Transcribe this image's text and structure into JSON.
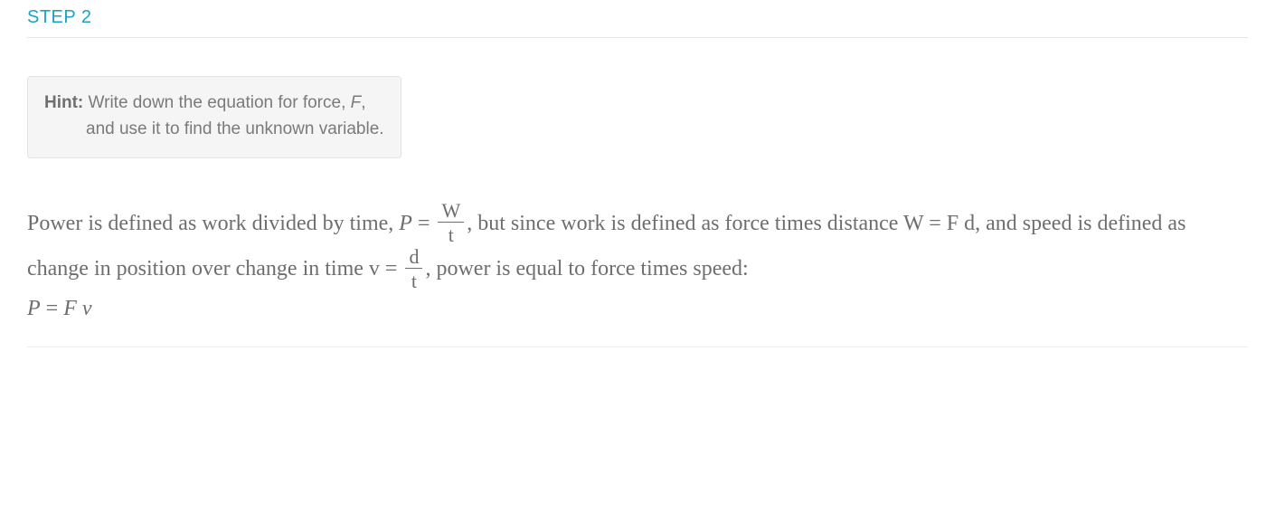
{
  "heading": "STEP 2",
  "hint": {
    "label": "Hint:",
    "line1": "Write down the equation for force, ",
    "var1": "F",
    "line1_tail": ",",
    "line2": "and use it to find the unknown variable."
  },
  "body": {
    "seg1": "Power is defined as work divided by time, ",
    "P": "P",
    "eq": " = ",
    "frac1_num": "W",
    "frac1_den": "t",
    "seg2": ", but since work is defined as force times distance ",
    "W": "W",
    "eq2": " = ",
    "F": "F",
    "sp": " ",
    "d": "d",
    "seg3": ", and speed is defined as change in position over change in time ",
    "v": "v",
    "eq3": " = ",
    "frac2_num": "d",
    "frac2_den": "t",
    "seg4": ", power is equal to force times speed:"
  },
  "equation": {
    "P": "P",
    "eq": " = ",
    "F": "F",
    "sp": " ",
    "v": "v"
  }
}
